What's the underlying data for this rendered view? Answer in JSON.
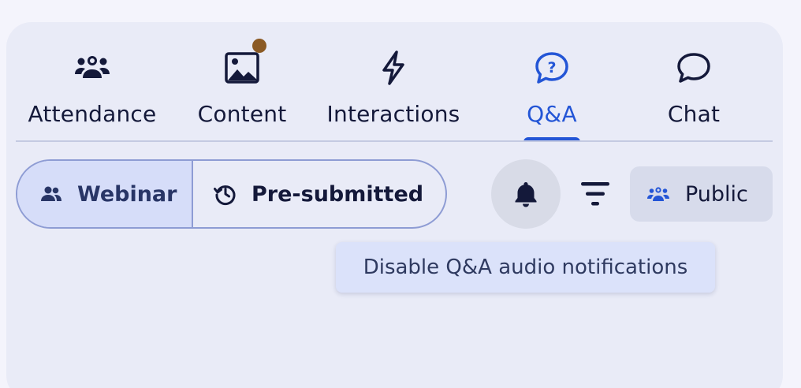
{
  "tabs": [
    {
      "label": "Attendance",
      "icon": "people-group-icon",
      "active": false
    },
    {
      "label": "Content",
      "icon": "image-icon",
      "active": false,
      "has_notification": true
    },
    {
      "label": "Interactions",
      "icon": "lightning-bolt-icon",
      "active": false
    },
    {
      "label": "Q&A",
      "icon": "question-bubble-icon",
      "active": true
    },
    {
      "label": "Chat",
      "icon": "chat-bubble-icon",
      "active": false
    }
  ],
  "segmented": {
    "webinar_label": "Webinar",
    "presubmitted_label": "Pre-submitted",
    "selected": "Webinar"
  },
  "controls": {
    "bell_icon": "bell-icon",
    "filter_icon": "filter-icon",
    "public_label": "Public"
  },
  "tooltip": {
    "text": "Disable Q&A audio notifications"
  },
  "colors": {
    "accent": "#2355d6",
    "notification_dot": "#8b5a24",
    "panel_bg": "#e9ebf7",
    "text": "#14193a"
  }
}
